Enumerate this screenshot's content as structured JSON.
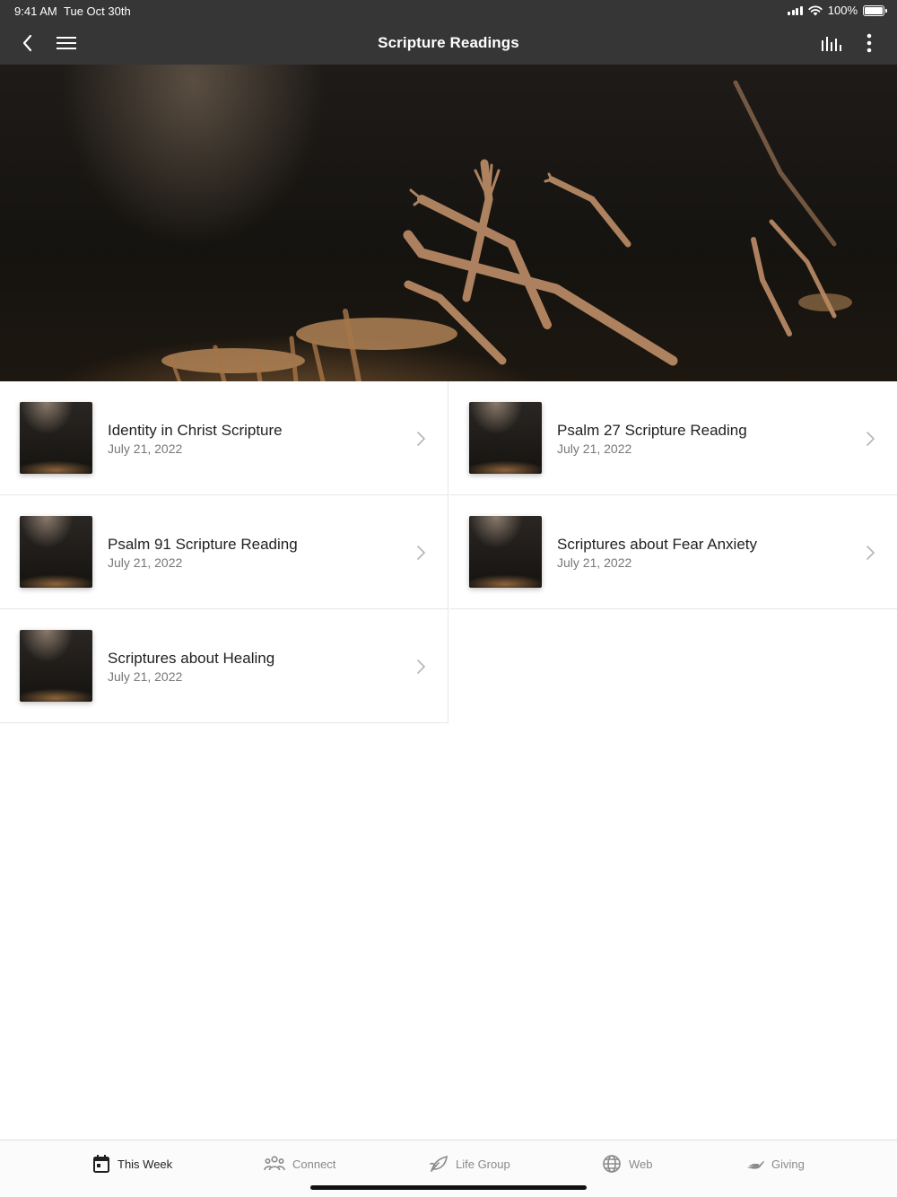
{
  "status_bar": {
    "time": "9:41 AM",
    "date": "Tue Oct 30th",
    "battery": "100%"
  },
  "nav": {
    "title": "Scripture Readings",
    "icons": [
      "chevron-left-icon",
      "hamburger-menu-icon",
      "bar-chart-icon",
      "more-vertical-icon"
    ]
  },
  "items": [
    {
      "title": "Identity in Christ Scripture",
      "date": "July 21, 2022"
    },
    {
      "title": "Psalm 27 Scripture Reading",
      "date": "July 21, 2022"
    },
    {
      "title": "Psalm 91 Scripture Reading",
      "date": "July 21, 2022"
    },
    {
      "title": "Scriptures about Fear Anxiety",
      "date": "July 21, 2022"
    },
    {
      "title": "Scriptures about Healing",
      "date": "July 21, 2022"
    }
  ],
  "tabs": [
    {
      "label": "This Week",
      "icon": "calendar-icon",
      "active": true
    },
    {
      "label": "Connect",
      "icon": "people-icon",
      "active": false
    },
    {
      "label": "Life Group",
      "icon": "leaf-icon",
      "active": false
    },
    {
      "label": "Web",
      "icon": "globe-icon",
      "active": false
    },
    {
      "label": "Giving",
      "icon": "giving-hand-icon",
      "active": false
    }
  ],
  "colors": {
    "header_bg": "#363636",
    "tab_active": "#1f1f1f",
    "tab_inactive": "#8a8a8a"
  }
}
